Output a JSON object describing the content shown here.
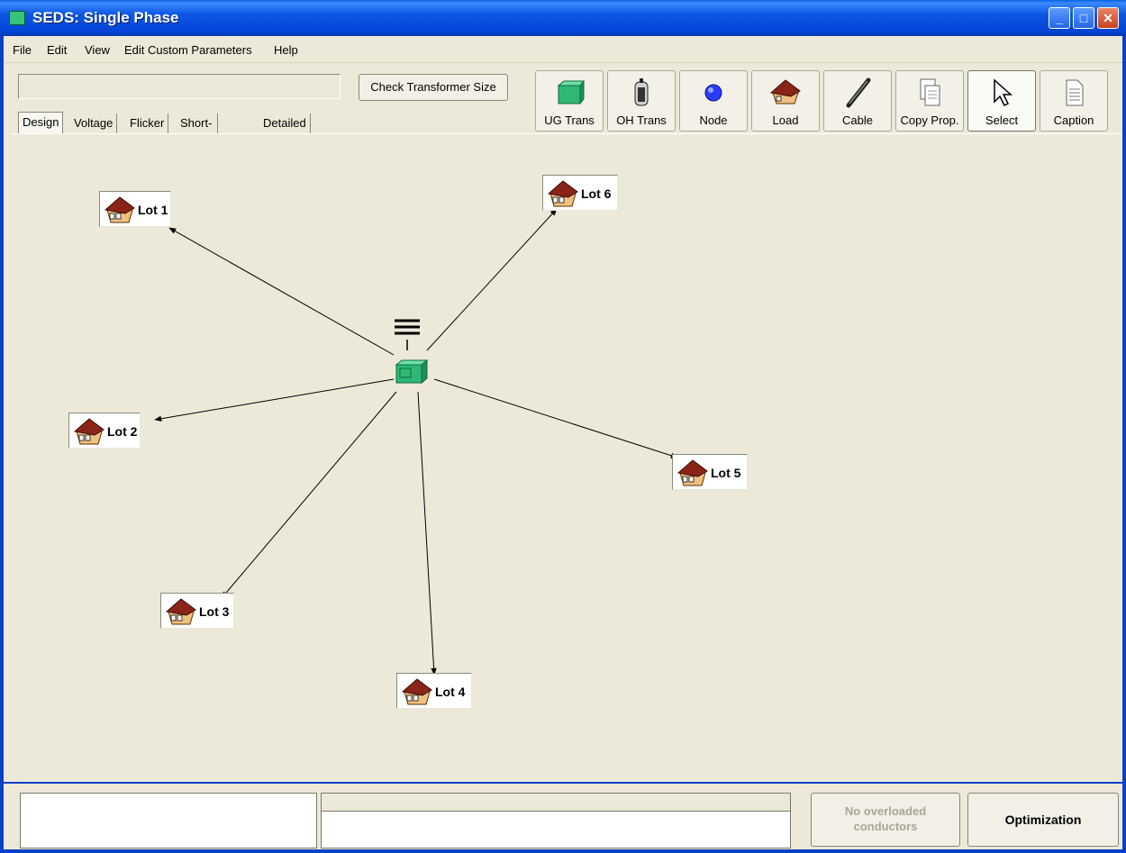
{
  "window": {
    "title": "SEDS: Single Phase",
    "minimize": "_",
    "maximize": "□",
    "close": "✕"
  },
  "menu": [
    "File",
    "Edit",
    "View",
    "Edit Custom Parameters",
    "Help"
  ],
  "header": {
    "status_value": "",
    "check_button": "Check Transformer Size"
  },
  "tabs": [
    "Design",
    "Voltage",
    "Flicker",
    "Short-Circuit",
    "Detailed Results"
  ],
  "active_tab": "Design",
  "toolbar": [
    {
      "label": "UG Trans",
      "icon": "ug-transformer-icon"
    },
    {
      "label": "OH Trans",
      "icon": "oh-transformer-icon"
    },
    {
      "label": "Node",
      "icon": "node-icon"
    },
    {
      "label": "Load",
      "icon": "house-icon"
    },
    {
      "label": "Cable",
      "icon": "cable-icon"
    },
    {
      "label": "Copy Prop.",
      "icon": "copy-icon"
    },
    {
      "label": "Select",
      "icon": "cursor-icon"
    },
    {
      "label": "Caption",
      "icon": "caption-icon"
    }
  ],
  "selected_tool": "Select",
  "diagram": {
    "source": "transformer-icon",
    "loads": [
      {
        "label": "Lot 1"
      },
      {
        "label": "Lot 2"
      },
      {
        "label": "Lot 3"
      },
      {
        "label": "Lot 4"
      },
      {
        "label": "Lot 5"
      },
      {
        "label": "Lot 6"
      }
    ],
    "colors": {
      "transformer": "#2fb874",
      "house_roof": "#8b2418",
      "line": "#000000"
    }
  },
  "bottom": {
    "overload_text": "No overloaded conductors",
    "optimization_button": "Optimization"
  }
}
